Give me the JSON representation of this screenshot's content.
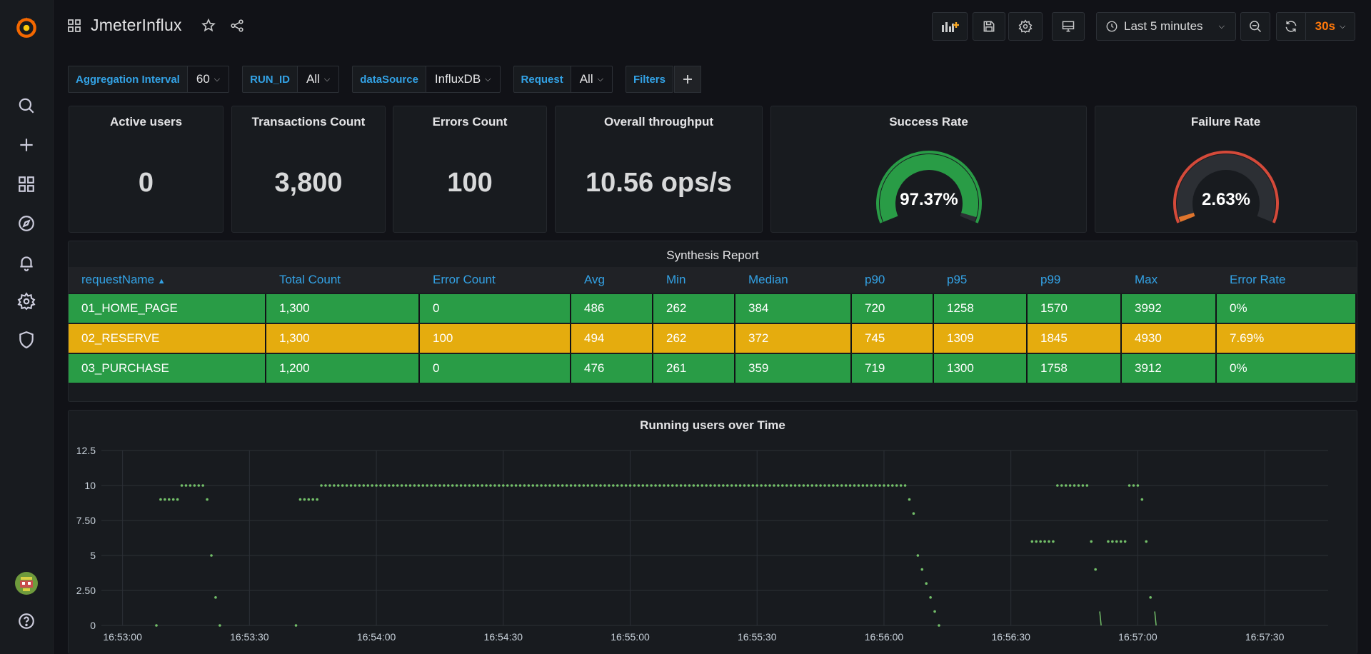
{
  "dashboard": {
    "title": "JmeterInflux"
  },
  "toolbar": {
    "time_range": "Last 5 minutes",
    "refresh_interval": "30s"
  },
  "variables": [
    {
      "label": "Aggregation Interval",
      "value": "60"
    },
    {
      "label": "RUN_ID",
      "value": "All"
    },
    {
      "label": "dataSource",
      "value": "InfluxDB"
    },
    {
      "label": "Request",
      "value": "All"
    }
  ],
  "filters_label": "Filters",
  "stats": {
    "active_users": {
      "title": "Active users",
      "value": "0"
    },
    "transactions": {
      "title": "Transactions Count",
      "value": "3,800"
    },
    "errors": {
      "title": "Errors Count",
      "value": "100"
    },
    "throughput": {
      "title": "Overall throughput",
      "value": "10.56 ops/s"
    },
    "success": {
      "title": "Success Rate",
      "value": "97.37%",
      "fraction": 0.9737,
      "color": "#299c46"
    },
    "failure": {
      "title": "Failure Rate",
      "value": "2.63%",
      "fraction": 0.0263,
      "color": "#e0752d",
      "threshold_color": "#d44a3a"
    }
  },
  "table": {
    "title": "Synthesis Report",
    "headers": [
      "requestName",
      "Total Count",
      "Error Count",
      "Avg",
      "Min",
      "Median",
      "p90",
      "p95",
      "p99",
      "Max",
      "Error Rate"
    ],
    "rows": [
      {
        "cells": [
          "01_HOME_PAGE",
          "1,300",
          "0",
          "486",
          "262",
          "384",
          "720",
          "1258",
          "1570",
          "3992",
          "0%"
        ],
        "color": "#299c46"
      },
      {
        "cells": [
          "02_RESERVE",
          "1,300",
          "100",
          "494",
          "262",
          "372",
          "745",
          "1309",
          "1845",
          "4930",
          "7.69%"
        ],
        "color": "#e5ac0e"
      },
      {
        "cells": [
          "03_PURCHASE",
          "1,200",
          "0",
          "476",
          "261",
          "359",
          "719",
          "1300",
          "1758",
          "3912",
          "0%"
        ],
        "color": "#299c46"
      }
    ]
  },
  "chart_data": {
    "type": "scatter",
    "title": "Running users over Time",
    "x_tick_labels": [
      "16:53:00",
      "16:53:30",
      "16:54:00",
      "16:54:30",
      "16:55:00",
      "16:55:30",
      "16:56:00",
      "16:56:30",
      "16:57:00",
      "16:57:30"
    ],
    "y_tick_labels": [
      "0",
      "2.50",
      "5",
      "7.50",
      "10",
      "12.5"
    ],
    "ylim": [
      0,
      12.5
    ],
    "xlim": [
      "16:52:55",
      "16:57:45"
    ],
    "grid": true,
    "color": "#73bf69",
    "series": [
      {
        "points": [
          [
            "16:53:08",
            0
          ],
          [
            "16:53:09",
            9
          ],
          [
            "16:53:10",
            9
          ],
          [
            "16:53:11",
            9
          ],
          [
            "16:53:12",
            9
          ],
          [
            "16:53:13",
            9
          ],
          [
            "16:53:14",
            10
          ],
          [
            "16:53:15",
            10
          ],
          [
            "16:53:16",
            10
          ],
          [
            "16:53:17",
            10
          ],
          [
            "16:53:18",
            10
          ],
          [
            "16:53:19",
            10
          ],
          [
            "16:53:20",
            9
          ],
          [
            "16:53:21",
            5
          ],
          [
            "16:53:22",
            2
          ],
          [
            "16:53:23",
            0
          ],
          [
            "16:53:41",
            0
          ],
          [
            "16:53:42",
            9
          ],
          [
            "16:53:43",
            9
          ],
          [
            "16:53:44",
            9
          ],
          [
            "16:53:45",
            9
          ],
          [
            "16:53:46",
            9
          ],
          [
            "16:56:06",
            9
          ],
          [
            "16:56:07",
            8
          ],
          [
            "16:56:08",
            5
          ],
          [
            "16:56:09",
            4
          ],
          [
            "16:56:10",
            3
          ],
          [
            "16:56:11",
            2
          ],
          [
            "16:56:12",
            1
          ],
          [
            "16:56:13",
            0
          ],
          [
            "16:56:35",
            6
          ],
          [
            "16:56:36",
            6
          ],
          [
            "16:56:37",
            6
          ],
          [
            "16:56:38",
            6
          ],
          [
            "16:56:39",
            6
          ],
          [
            "16:56:40",
            6
          ],
          [
            "16:56:41",
            10
          ],
          [
            "16:56:42",
            10
          ],
          [
            "16:56:43",
            10
          ],
          [
            "16:56:44",
            10
          ],
          [
            "16:56:45",
            10
          ],
          [
            "16:56:46",
            10
          ],
          [
            "16:56:47",
            10
          ],
          [
            "16:56:48",
            10
          ],
          [
            "16:56:49",
            6
          ],
          [
            "16:56:50",
            4
          ],
          [
            "16:56:53",
            6
          ],
          [
            "16:56:54",
            6
          ],
          [
            "16:56:55",
            6
          ],
          [
            "16:56:56",
            6
          ],
          [
            "16:56:57",
            6
          ],
          [
            "16:56:58",
            10
          ],
          [
            "16:56:59",
            10
          ],
          [
            "16:57:00",
            10
          ],
          [
            "16:57:01",
            9
          ],
          [
            "16:57:02",
            6
          ],
          [
            "16:57:03",
            2
          ]
        ],
        "constant_segment": {
          "from": "16:53:47",
          "to": "16:56:05",
          "value": 10,
          "step_seconds": 1
        },
        "spikes": [
          [
            "16:56:51",
            1
          ],
          [
            "16:57:04",
            1
          ]
        ]
      }
    ]
  }
}
